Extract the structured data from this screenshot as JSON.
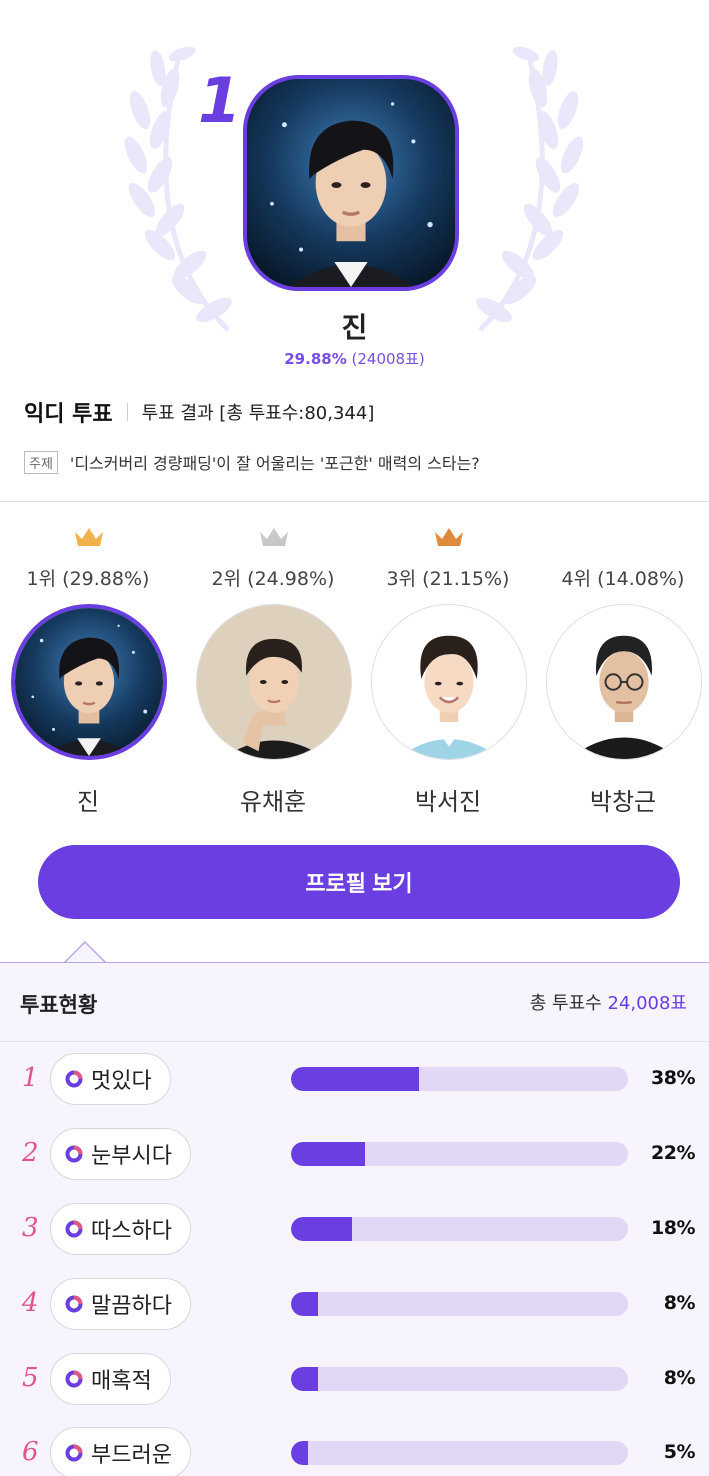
{
  "hero": {
    "rank": "1",
    "name": "진",
    "percent": "29.88%",
    "votes": "(24008표)"
  },
  "header": {
    "brand": "익디 투표",
    "result_label": "투표 결과 [총 투표수:80,344]",
    "topic_tag": "주제",
    "topic_text": "'디스커버리 경량패딩'이 잘 어울리는 '포근한' 매력의 스타는?"
  },
  "ranking": [
    {
      "label": "1위 (29.88%)",
      "name": "진",
      "crown": "gold"
    },
    {
      "label": "2위 (24.98%)",
      "name": "유채훈",
      "crown": "silver"
    },
    {
      "label": "3위 (21.15%)",
      "name": "박서진",
      "crown": "bronze"
    },
    {
      "label": "4위 (14.08%)",
      "name": "박창근",
      "crown": "none"
    }
  ],
  "colors": {
    "accent": "#6a3ee0",
    "gold_crown": "#f0b04a",
    "silver_crown": "#c8c8c8",
    "bronze_crown": "#e08a3c",
    "rank_index": "#e0558a"
  },
  "profile_button": "프로필 보기",
  "status": {
    "title": "투표현황",
    "total_label": "총 투표수",
    "total_value": "24,008표",
    "items": [
      {
        "index": "1",
        "label": "멋있다",
        "percent_text": "38%",
        "fraction": 0.38
      },
      {
        "index": "2",
        "label": "눈부시다",
        "percent_text": "22%",
        "fraction": 0.22
      },
      {
        "index": "3",
        "label": "따스하다",
        "percent_text": "18%",
        "fraction": 0.18
      },
      {
        "index": "4",
        "label": "말끔하다",
        "percent_text": "8%",
        "fraction": 0.08
      },
      {
        "index": "5",
        "label": "매혹적",
        "percent_text": "8%",
        "fraction": 0.08
      },
      {
        "index": "6",
        "label": "부드러운",
        "percent_text": "5%",
        "fraction": 0.05
      }
    ]
  }
}
